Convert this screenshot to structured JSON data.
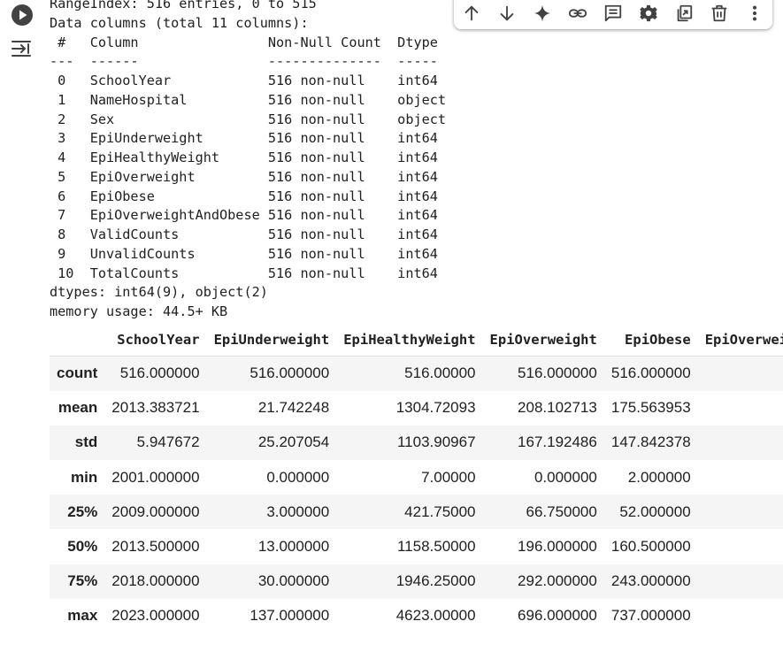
{
  "cell": {
    "run_icon": "play-circle-icon",
    "output_icon": "output-collapse-icon"
  },
  "toolbar": {
    "buttons": [
      {
        "icon": "arrow-up-icon"
      },
      {
        "icon": "arrow-down-icon"
      },
      {
        "icon": "sparkle-icon"
      },
      {
        "icon": "link-icon"
      },
      {
        "icon": "comment-icon"
      },
      {
        "icon": "gear-icon"
      },
      {
        "icon": "mirror-cell-icon"
      },
      {
        "icon": "trash-icon"
      },
      {
        "icon": "more-vert-icon"
      }
    ]
  },
  "info_output": {
    "range_index": "RangeIndex: 516 entries, 0 to 515",
    "data_columns": "Data columns (total 11 columns):",
    "header": " #   Column                Non-Null Count  Dtype ",
    "separator": "---  ------                --------------  ----- ",
    "rows": [
      " 0   SchoolYear            516 non-null    int64 ",
      " 1   NameHospital          516 non-null    object",
      " 2   Sex                   516 non-null    object",
      " 3   EpiUnderweight        516 non-null    int64 ",
      " 4   EpiHealthyWeight      516 non-null    int64 ",
      " 5   EpiOverweight         516 non-null    int64 ",
      " 6   EpiObese              516 non-null    int64 ",
      " 7   EpiOverweightAndObese 516 non-null    int64 ",
      " 8   ValidCounts           516 non-null    int64 ",
      " 9   UnvalidCounts         516 non-null    int64 ",
      " 10  TotalCounts           516 non-null    int64 "
    ],
    "dtypes": "dtypes: int64(9), object(2)",
    "memory": "memory usage: 44.5+ KB"
  },
  "describe_table": {
    "columns": [
      "SchoolYear",
      "EpiUnderweight",
      "EpiHealthyWeight",
      "EpiOverweight",
      "EpiObese",
      "EpiOverweightAndObese"
    ],
    "rows": [
      {
        "label": "count",
        "values": [
          "516.000000",
          "516.000000",
          "516.00000",
          "516.000000",
          "516.000000",
          ""
        ]
      },
      {
        "label": "mean",
        "values": [
          "2013.383721",
          "21.742248",
          "1304.72093",
          "208.102713",
          "175.563953",
          ""
        ]
      },
      {
        "label": "std",
        "values": [
          "5.947672",
          "25.207054",
          "1103.90967",
          "167.192486",
          "147.842378",
          ""
        ]
      },
      {
        "label": "min",
        "values": [
          "2001.000000",
          "0.000000",
          "7.00000",
          "0.000000",
          "2.000000",
          ""
        ]
      },
      {
        "label": "25%",
        "values": [
          "2009.000000",
          "3.000000",
          "421.75000",
          "66.750000",
          "52.000000",
          ""
        ]
      },
      {
        "label": "50%",
        "values": [
          "2013.500000",
          "13.000000",
          "1158.50000",
          "196.000000",
          "160.500000",
          ""
        ]
      },
      {
        "label": "75%",
        "values": [
          "2018.000000",
          "30.000000",
          "1946.25000",
          "292.000000",
          "243.000000",
          ""
        ]
      },
      {
        "label": "max",
        "values": [
          "2023.000000",
          "137.000000",
          "4623.00000",
          "696.000000",
          "737.000000",
          ""
        ]
      }
    ]
  }
}
